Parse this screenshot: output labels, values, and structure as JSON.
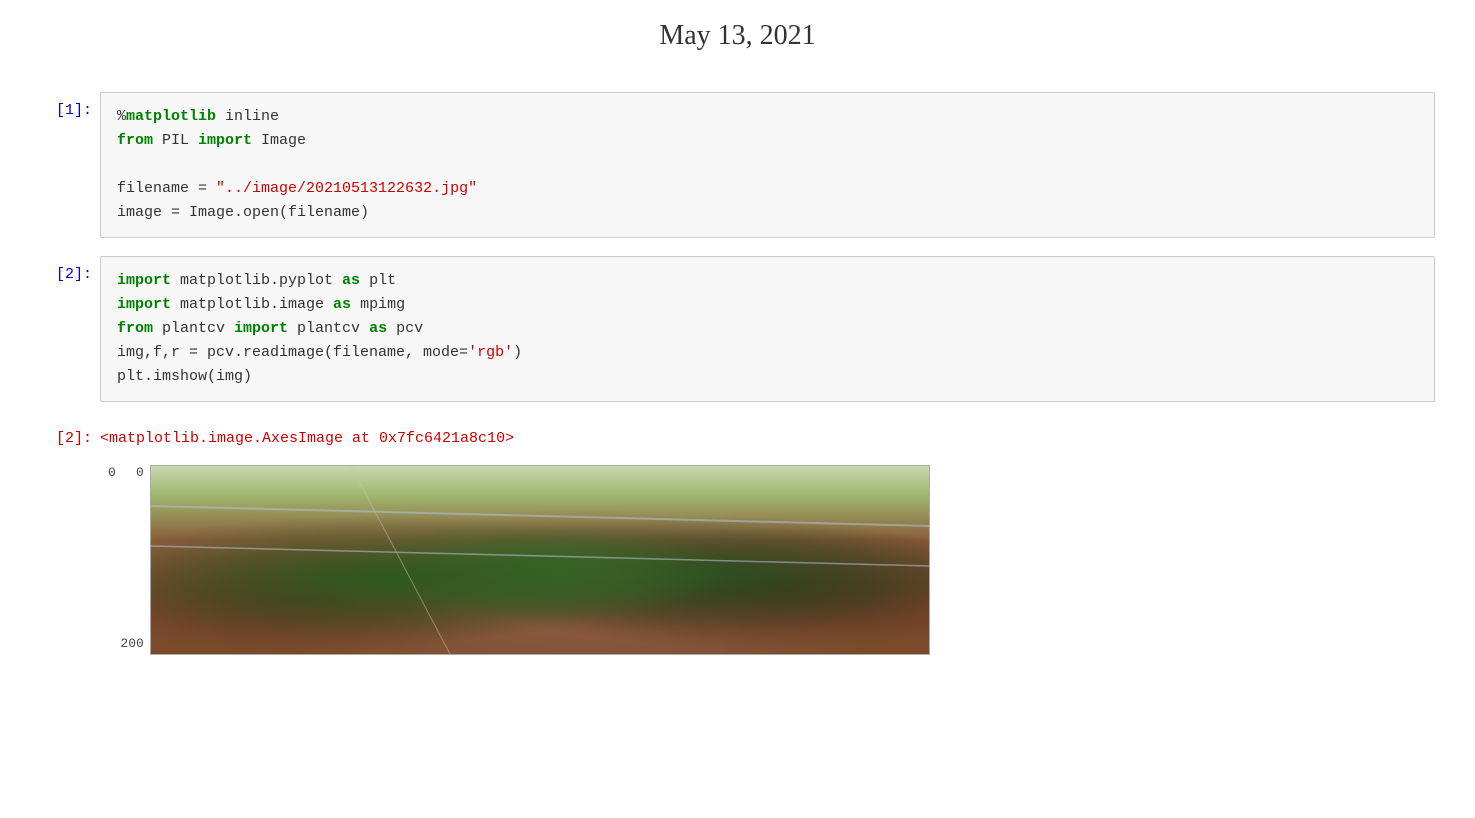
{
  "header": {
    "title": "May 13, 2021"
  },
  "cells": [
    {
      "id": "cell1",
      "label": "[1]:",
      "label_color": "blue",
      "lines": [
        {
          "parts": [
            {
              "text": "%",
              "style": "plain"
            },
            {
              "text": "matplotlib",
              "style": "kw-green"
            },
            {
              "text": " inline",
              "style": "plain"
            }
          ]
        },
        {
          "parts": [
            {
              "text": "from",
              "style": "kw-green"
            },
            {
              "text": " PIL ",
              "style": "plain"
            },
            {
              "text": "import",
              "style": "kw-green"
            },
            {
              "text": " Image",
              "style": "plain"
            }
          ]
        },
        {
          "parts": []
        },
        {
          "parts": [
            {
              "text": "filename = ",
              "style": "plain"
            },
            {
              "text": "\"../image/20210513122632.jpg\"",
              "style": "kw-red"
            }
          ]
        },
        {
          "parts": [
            {
              "text": "image = Image.open(filename)",
              "style": "plain"
            }
          ]
        }
      ]
    },
    {
      "id": "cell2",
      "label": "[2]:",
      "label_color": "blue",
      "lines": [
        {
          "parts": [
            {
              "text": "import",
              "style": "kw-green"
            },
            {
              "text": " matplotlib.pyplot ",
              "style": "plain"
            },
            {
              "text": "as",
              "style": "kw-green"
            },
            {
              "text": " plt",
              "style": "plain"
            }
          ]
        },
        {
          "parts": [
            {
              "text": "import",
              "style": "kw-green"
            },
            {
              "text": " matplotlib.image ",
              "style": "plain"
            },
            {
              "text": "as",
              "style": "kw-green"
            },
            {
              "text": " mpimg",
              "style": "plain"
            }
          ]
        },
        {
          "parts": [
            {
              "text": "from",
              "style": "kw-green"
            },
            {
              "text": " plantcv ",
              "style": "plain"
            },
            {
              "text": "import",
              "style": "kw-green"
            },
            {
              "text": " plantcv ",
              "style": "plain"
            },
            {
              "text": "as",
              "style": "kw-green"
            },
            {
              "text": " pcv",
              "style": "plain"
            }
          ]
        },
        {
          "parts": [
            {
              "text": "img,f,r = pcv.readimage(filename, mode=",
              "style": "plain"
            },
            {
              "text": "'rgb'",
              "style": "kw-red"
            },
            {
              "text": ")",
              "style": "plain"
            }
          ]
        },
        {
          "parts": [
            {
              "text": "plt.imshow(img)",
              "style": "plain"
            }
          ]
        }
      ]
    }
  ],
  "output": {
    "label": "[2]:",
    "text": "<matplotlib.image.AxesImage at 0x7fc6421a8c10>"
  },
  "plot": {
    "x_label": "0",
    "y_label_top": "0",
    "y_label_200": "200"
  }
}
